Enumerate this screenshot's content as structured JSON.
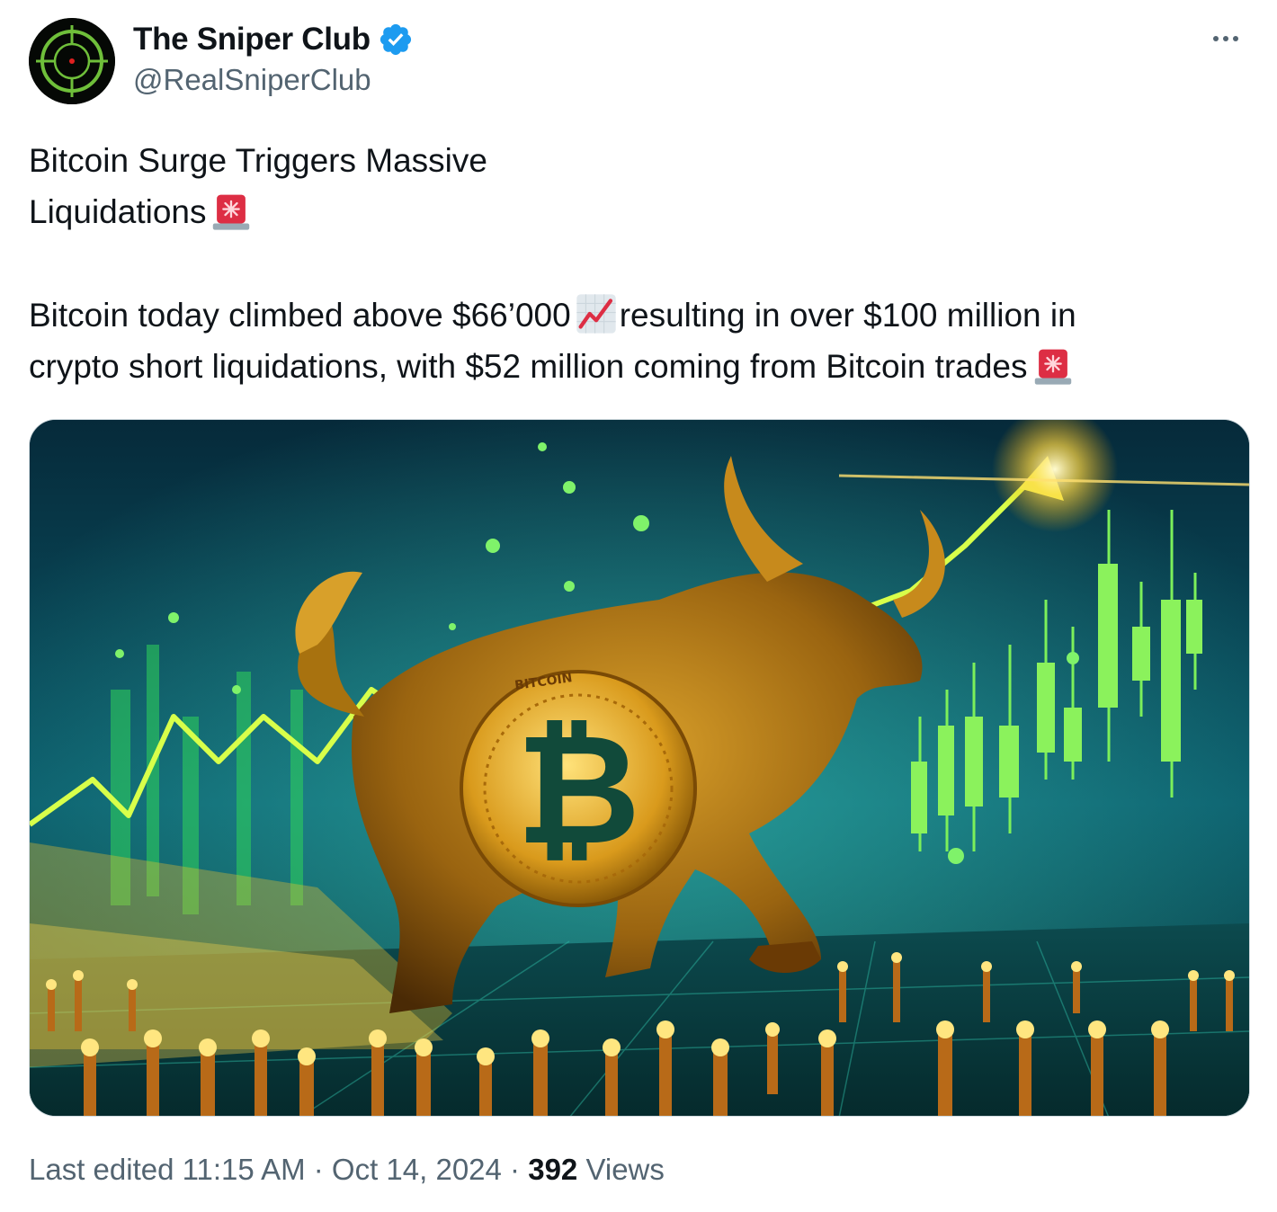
{
  "author": {
    "display_name": "The Sniper Club",
    "handle": "@RealSniperClub",
    "avatar_icon": "crosshair-scope-icon",
    "verified_icon": "verified-badge-icon",
    "verified_color": "#1d9bf0"
  },
  "more_icon": "more-horizontal-icon",
  "tweet": {
    "line1": "Bitcoin Surge Triggers Massive",
    "line2": "Liquidations",
    "line3a": "Bitcoin today climbed above $66’000",
    "line3b": "resulting in over $100 million in",
    "line4": "crypto short liquidations, with $52 million coming from Bitcoin trades",
    "emoji_siren": "police-car-light-emoji",
    "emoji_chart": "chart-increasing-emoji"
  },
  "media": {
    "image_kind": "illustration",
    "coin_text": "BITCOIN"
  },
  "meta": {
    "edited_label": "Last edited 11:15 AM · Oct 14, 2024 · ",
    "views_count": "392",
    "views_label": " Views"
  }
}
